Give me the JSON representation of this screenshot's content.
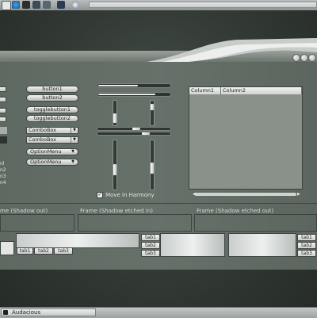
{
  "panel": {
    "launchers": [
      "files-icon",
      "browser-icon",
      "terminal-icon",
      "media-icon",
      "mail-icon",
      "help-icon",
      "settings-icon"
    ]
  },
  "buttons": {
    "button1": "button1",
    "button2": "button2",
    "toggle1": "togglebutton1",
    "toggle2": "togglebutton2"
  },
  "combos": {
    "combo1": "ComboBox",
    "combo2": "ComboBox"
  },
  "option_menus": {
    "opt1": "OptionMenu",
    "opt2": "OptionMenu"
  },
  "left_clipped": {
    "l1": "nl",
    "l2": "n2",
    "l3": "n3",
    "l4": "n4"
  },
  "scales": {
    "h1": 0.55,
    "h2": 0.8,
    "v1": 0.75,
    "v2": 0.7
  },
  "checkbox": {
    "label": "Move in Harmony",
    "checked": true
  },
  "tree": {
    "columns": [
      "Column1",
      "Column2"
    ]
  },
  "frames": {
    "f1": "me (Shadow out)",
    "f2": "Frame (Shadow etched in)",
    "f3": "Frame (Shadow etched out)"
  },
  "notebooks": {
    "tabs": [
      "tab1",
      "tab2",
      "tab3"
    ]
  },
  "taskbar": {
    "app_title": "Audacious"
  }
}
